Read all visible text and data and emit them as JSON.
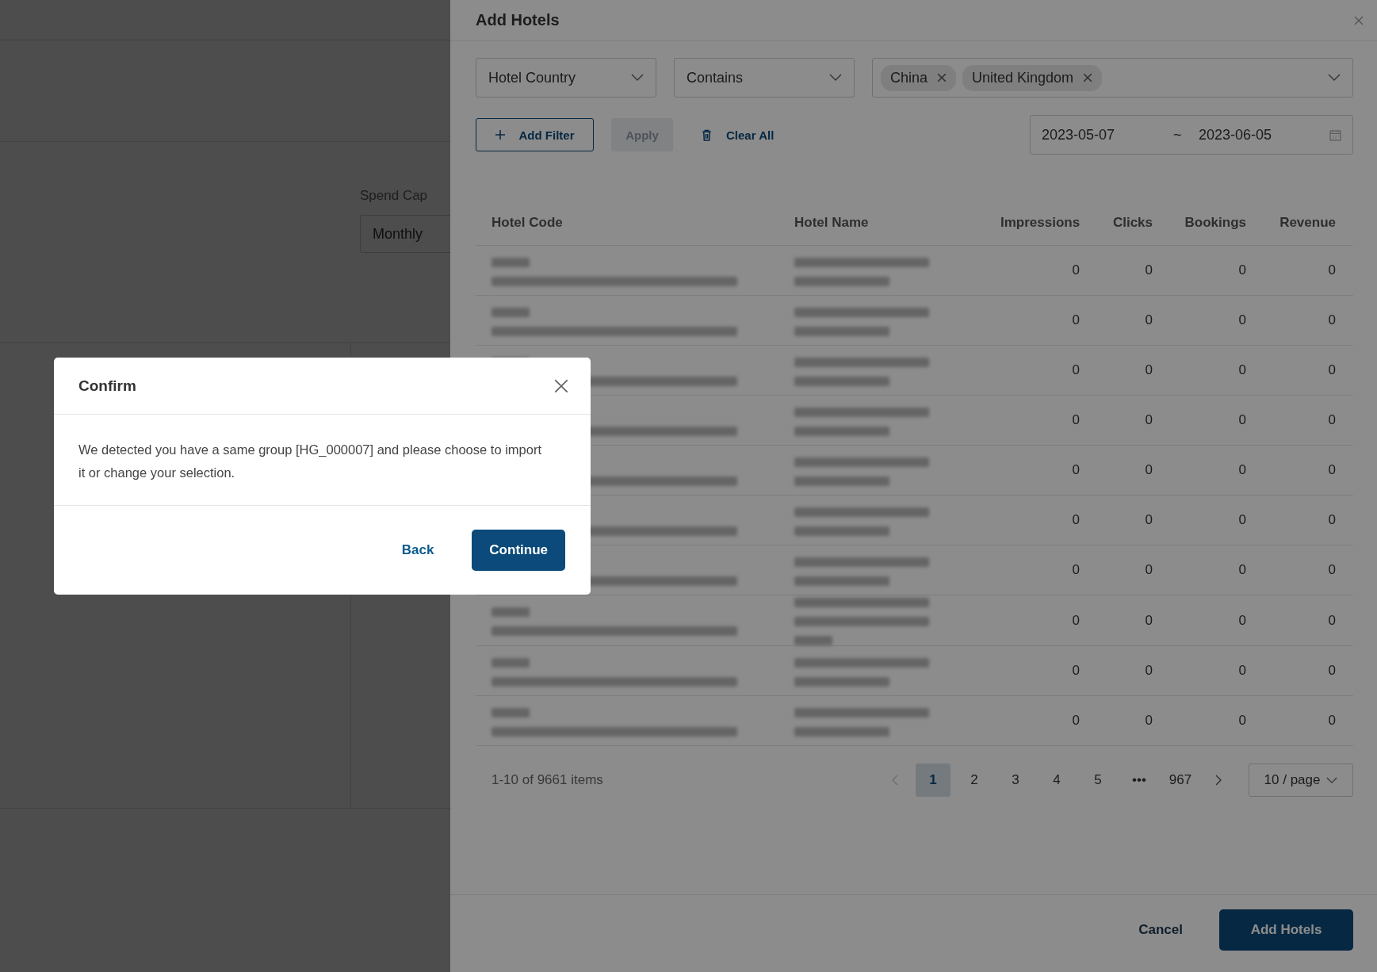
{
  "background": {
    "spend_cap": {
      "label": "Spend Cap",
      "value": "Monthly"
    }
  },
  "drawer": {
    "title": "Add Hotels",
    "filters": {
      "field": "Hotel Country",
      "operator": "Contains",
      "tags": [
        "China",
        "United Kingdom"
      ]
    },
    "add_filter": "Add Filter",
    "apply": {
      "label": "Apply",
      "disabled": true
    },
    "clear_all": "Clear All",
    "date_range": {
      "start": "2023-05-07",
      "separator": "~",
      "end": "2023-06-05"
    },
    "table": {
      "columns": [
        "Hotel Code",
        "Hotel Name",
        "Impressions",
        "Clicks",
        "Bookings",
        "Revenue"
      ],
      "rows": [
        {
          "impressions": "0",
          "clicks": "0",
          "bookings": "0",
          "revenue": "0"
        },
        {
          "impressions": "0",
          "clicks": "0",
          "bookings": "0",
          "revenue": "0"
        },
        {
          "impressions": "0",
          "clicks": "0",
          "bookings": "0",
          "revenue": "0"
        },
        {
          "impressions": "0",
          "clicks": "0",
          "bookings": "0",
          "revenue": "0"
        },
        {
          "impressions": "0",
          "clicks": "0",
          "bookings": "0",
          "revenue": "0"
        },
        {
          "impressions": "0",
          "clicks": "0",
          "bookings": "0",
          "revenue": "0"
        },
        {
          "impressions": "0",
          "clicks": "0",
          "bookings": "0",
          "revenue": "0"
        },
        {
          "kind": "three-line",
          "impressions": "0",
          "clicks": "0",
          "bookings": "0",
          "revenue": "0"
        },
        {
          "impressions": "0",
          "clicks": "0",
          "bookings": "0",
          "revenue": "0"
        },
        {
          "impressions": "0",
          "clicks": "0",
          "bookings": "0",
          "revenue": "0"
        }
      ]
    },
    "pagination": {
      "summary": "1-10 of 9661 items",
      "prev_disabled": true,
      "pages": [
        {
          "label": "1",
          "selected": true
        },
        {
          "label": "2",
          "selected": false
        },
        {
          "label": "3",
          "selected": false
        },
        {
          "label": "4",
          "selected": false
        },
        {
          "label": "5",
          "selected": false
        },
        {
          "label": "•••",
          "selected": false
        },
        {
          "label": "967",
          "selected": false
        }
      ],
      "page_size": "10 / page"
    },
    "footer": {
      "cancel": "Cancel",
      "submit": "Add Hotels"
    }
  },
  "dialog": {
    "title": "Confirm",
    "message": "We detected you have a same group [HG_000007] and please choose to import it or change your selection.",
    "back": "Back",
    "continue": "Continue"
  }
}
